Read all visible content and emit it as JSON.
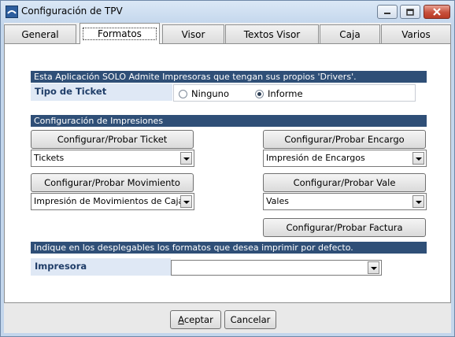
{
  "window": {
    "title": "Configuración de TPV"
  },
  "tabs": [
    {
      "label": "General"
    },
    {
      "label": "Formatos"
    },
    {
      "label": "Visor"
    },
    {
      "label": "Textos Visor"
    },
    {
      "label": "Caja"
    },
    {
      "label": "Varios"
    }
  ],
  "notice": "Esta Aplicación SOLO Admite Impresoras que tengan sus propios 'Drivers'.",
  "ticket_type": {
    "label": "Tipo de Ticket",
    "options": [
      "Ninguno",
      "Informe"
    ],
    "selected": "Informe"
  },
  "print_config": {
    "header": "Configuración de Impresiones",
    "ticket_button": "Configurar/Probar Ticket",
    "ticket_value": "Tickets",
    "encargo_button": "Configurar/Probar Encargo",
    "encargo_value": "Impresión de Encargos",
    "movimiento_button": "Configurar/Probar Movimiento",
    "movimiento_value": "Impresión de Movimientos de Caja",
    "vale_button": "Configurar/Probar Vale",
    "vale_value": "Vales",
    "factura_button": "Configurar/Probar Factura"
  },
  "defaults": {
    "header": "Indique en los desplegables los formatos que desea imprimir por defecto.",
    "printer_label": "Impresora",
    "printer_value": ""
  },
  "footer": {
    "accept_mnemonic": "A",
    "accept_rest": "ceptar",
    "cancel": "Cancelar"
  },
  "colors": {
    "section_bar": "#2f4f77",
    "label_text": "#1f3d68",
    "label_bg": "#dfe8f5"
  },
  "icons": [
    "app-icon",
    "minimize-icon",
    "maximize-icon",
    "close-icon",
    "dropdown-arrow-icon"
  ]
}
